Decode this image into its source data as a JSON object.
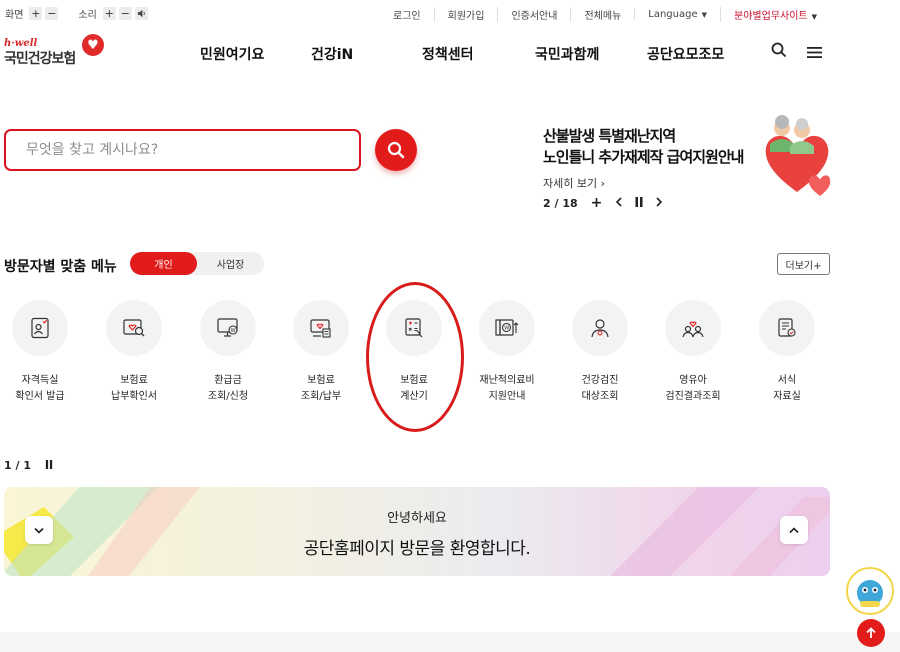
{
  "utility": {
    "screen_label": "화면",
    "sound_label": "소리",
    "plus": "+",
    "minus": "−",
    "links": [
      "로그인",
      "회원가입",
      "인증서안내",
      "전체메뉴"
    ],
    "language": "Language",
    "other_sites": "분야별업무사이트"
  },
  "logo": {
    "tagline": "h·well",
    "name": "국민건강보험"
  },
  "gnb": [
    "민원여기요",
    "건강iN",
    "정책센터",
    "국민과함께",
    "공단요모조모"
  ],
  "search": {
    "placeholder": "무엇을 찾고 계시나요?"
  },
  "banner": {
    "line1": "산불발생 특별재난지역",
    "line2": "노인틀니 추가재제작 급여지원안내",
    "more": "자세히 보기",
    "counter": "2 / 18",
    "plus": "+"
  },
  "custom_menu": {
    "title": "방문자별 맞춤 메뉴",
    "tab_personal": "개인",
    "tab_business": "사업장",
    "more": "더보기+",
    "items": [
      {
        "label": "자격득실\n확인서 발급",
        "icon": "id-card-icon"
      },
      {
        "label": "보험료\n납부확인서",
        "icon": "payment-search-icon"
      },
      {
        "label": "환급금\n조회/신청",
        "icon": "refund-monitor-icon"
      },
      {
        "label": "보험료\n조회/납부",
        "icon": "premium-receipt-icon"
      },
      {
        "label": "보험료\n계산기",
        "icon": "calculator-icon"
      },
      {
        "label": "재난적의료비\n지원안내",
        "icon": "medical-cost-icon"
      },
      {
        "label": "건강검진\n대상조회",
        "icon": "checkup-person-icon"
      },
      {
        "label": "영유아\n검진결과조회",
        "icon": "infant-checkup-icon"
      },
      {
        "label": "서식\n자료실",
        "icon": "document-form-icon"
      }
    ],
    "pager": "1 / 1"
  },
  "welcome": {
    "line1": "안녕하세요",
    "line2": "공단홈페이지 방문을 환영합니다."
  },
  "colors": {
    "accent": "#e21b1b",
    "text": "#222222"
  }
}
